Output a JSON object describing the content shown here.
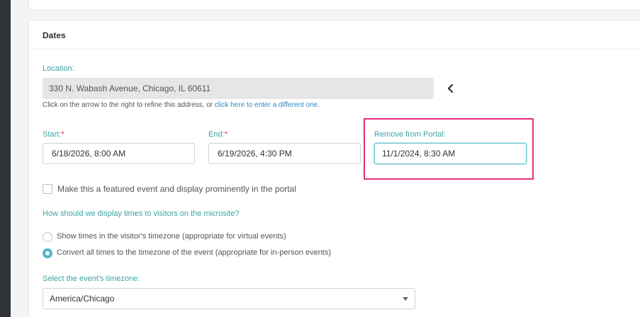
{
  "section": {
    "title": "Dates"
  },
  "location": {
    "label": "Location:",
    "address": "330 N. Wabash Avenue, Chicago, IL 60611",
    "hint_prefix": "Click on the arrow to the right to refine this address, or ",
    "hint_link": "click here to enter a different one."
  },
  "start": {
    "label": "Start:",
    "required": "*",
    "value": "6/18/2026, 8:00 AM"
  },
  "end": {
    "label": "End:",
    "required": "*",
    "value": "6/19/2026, 4:30 PM"
  },
  "remove": {
    "label": "Remove from Portal:",
    "value": "11/1/2024, 8:30 AM"
  },
  "featured": {
    "label": "Make this a featured event and display prominently in the portal",
    "checked": false
  },
  "display": {
    "question": "How should we display times to visitors on the microsite?",
    "options": [
      {
        "label": "Show times in the visitor's timezone (appropriate for virtual events)",
        "selected": false
      },
      {
        "label": "Convert all times to the timezone of the event (appropriate for in-person events)",
        "selected": true
      }
    ]
  },
  "timezone": {
    "label": "Select the event's timezone:",
    "value": "America/Chicago"
  },
  "colors": {
    "accent": "#3ba3a3",
    "highlight": "#e0307a",
    "link": "#2f86c4",
    "radio_on": "#4fb8c0"
  },
  "icons": {
    "chevron": "chevron-left-icon",
    "caret": "caret-down-icon"
  }
}
